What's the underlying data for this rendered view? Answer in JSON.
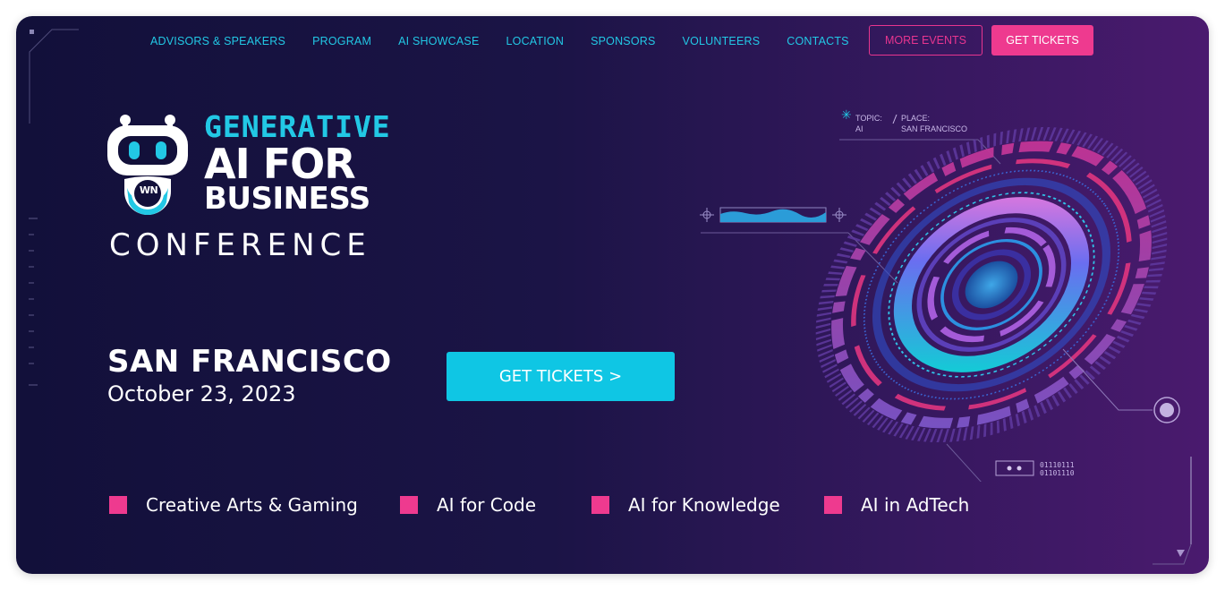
{
  "nav": {
    "links": [
      "ADVISORS & SPEAKERS",
      "PROGRAM",
      "AI SHOWCASE",
      "LOCATION",
      "SPONSORS",
      "VOLUNTEERS",
      "CONTACTS"
    ],
    "more_events": "MORE EVENTS",
    "get_tickets": "GET TICKETS"
  },
  "logo": {
    "badge_text": "WN",
    "line1": "GENERATIVE",
    "line2": "AI FOR",
    "line3": "BUSINESS",
    "line4": "CONFERENCE"
  },
  "event": {
    "city": "SAN FRANCISCO",
    "date": "October 23, 2023",
    "cta": "GET TICKETS >"
  },
  "hud": {
    "topic_label": "TOPIC:",
    "topic_value": "AI",
    "place_label": "PLACE:",
    "place_value": "SAN FRANCISCO",
    "binary_line1": "01110111",
    "binary_line2": "01101110"
  },
  "topics": [
    "Creative Arts & Gaming",
    "AI for Code",
    "AI for Knowledge",
    "AI in AdTech"
  ],
  "colors": {
    "accent_cyan": "#22c8e5",
    "accent_pink": "#ee3a8f",
    "background_dark": "#12103a",
    "background_purple": "#4a1a6e"
  }
}
